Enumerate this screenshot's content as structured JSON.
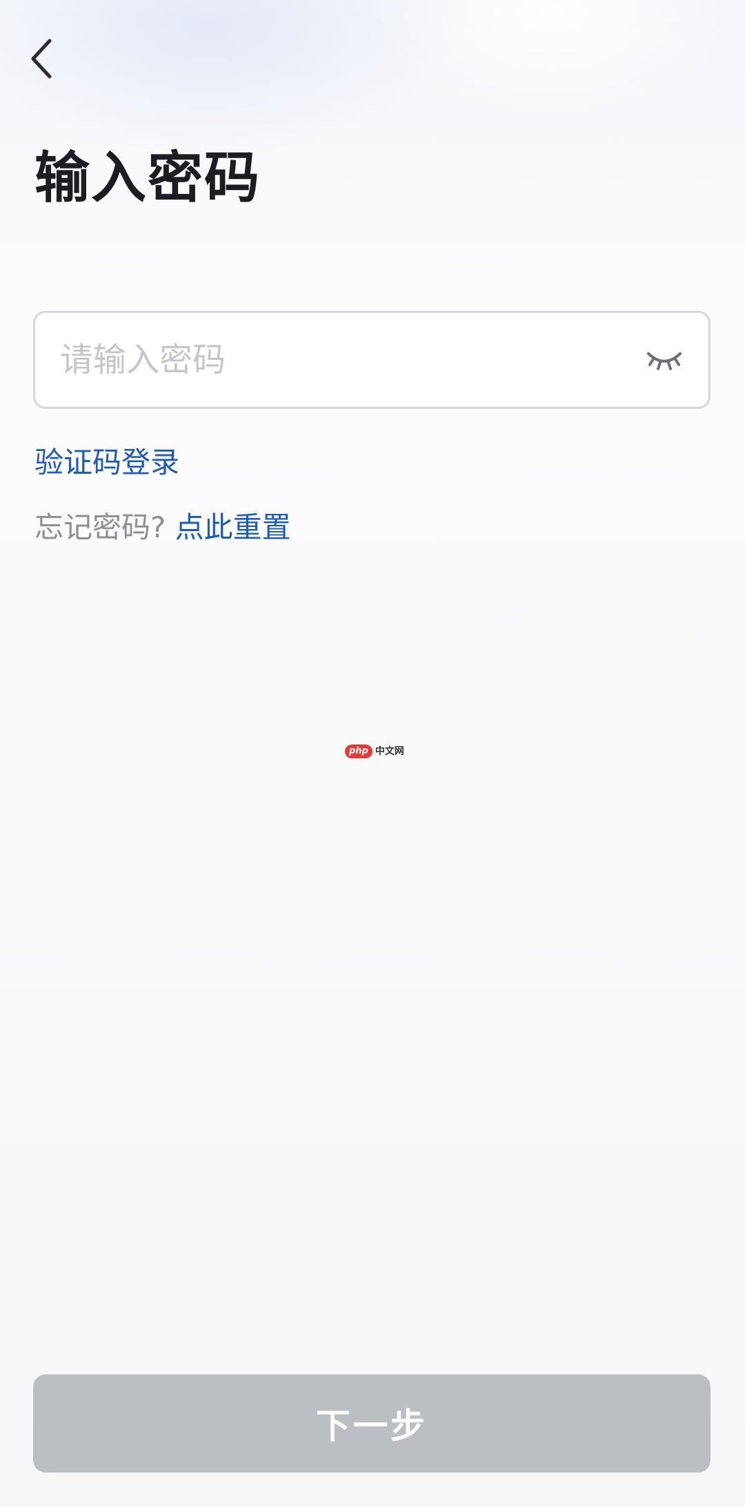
{
  "header": {
    "back_icon": "chevron-left-icon",
    "title": "输入密码"
  },
  "password": {
    "value": "",
    "placeholder": "请输入密码",
    "visibility_icon": "eye-closed-icon"
  },
  "links": {
    "sms_login": "验证码登录",
    "forgot_prompt": "忘记密码?",
    "reset": "点此重置"
  },
  "watermark": {
    "badge": "php",
    "text": "中文网"
  },
  "footer": {
    "next_label": "下一步",
    "enabled": false
  },
  "colors": {
    "link": "#1f5bb8",
    "title": "#1c1c22",
    "button_disabled": "#bbbec3",
    "placeholder": "#c4c6cc"
  }
}
